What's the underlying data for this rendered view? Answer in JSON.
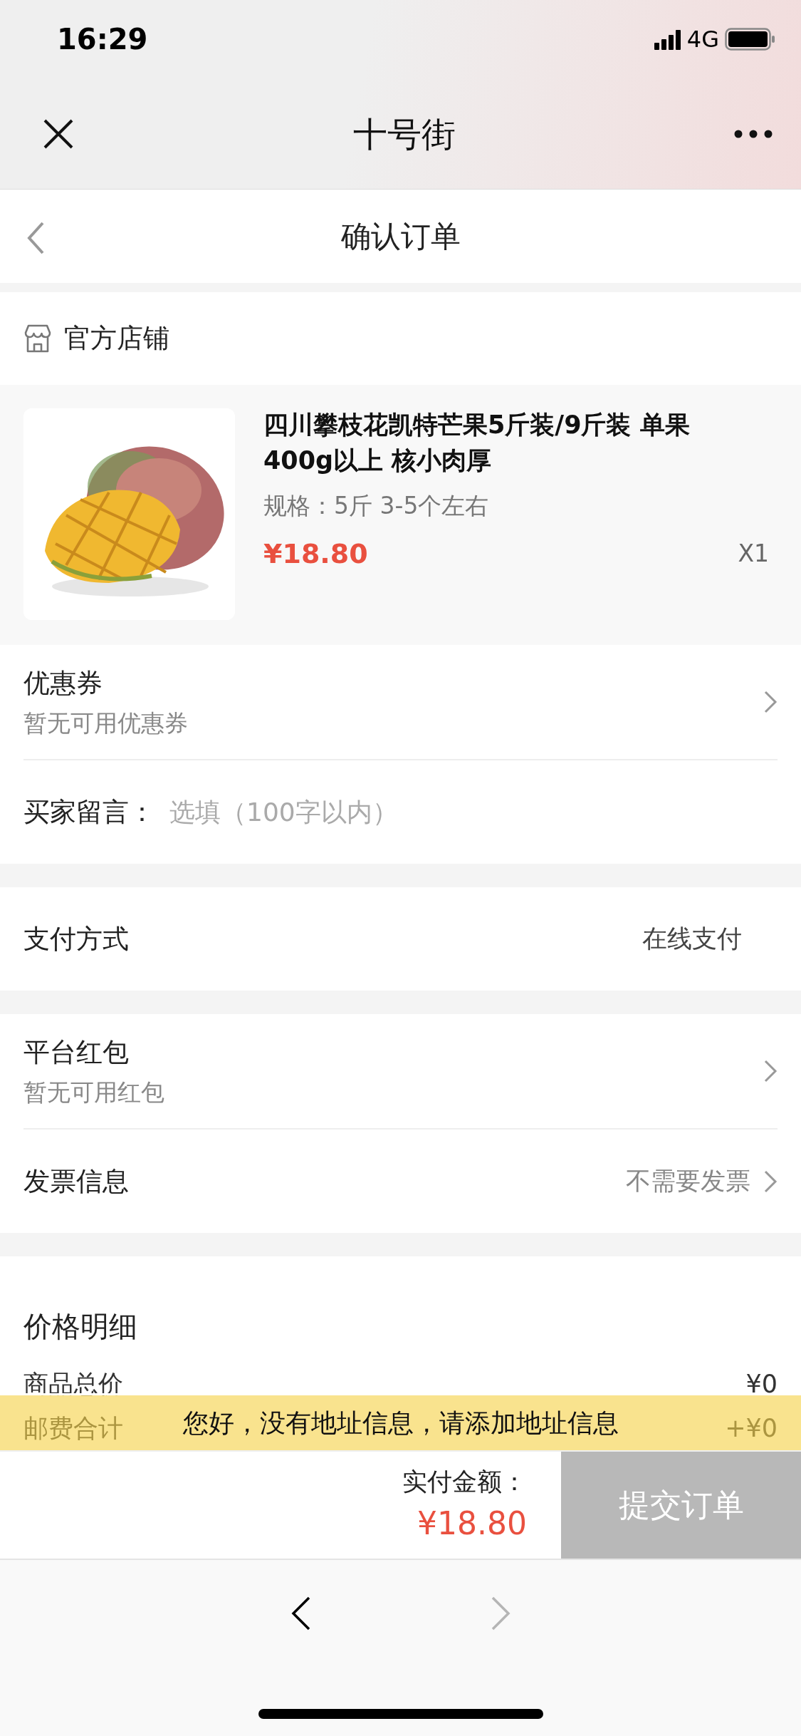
{
  "status_bar": {
    "time": "16:29",
    "network": "4G"
  },
  "app_bar": {
    "title": "十号街"
  },
  "header": {
    "title": "确认订单"
  },
  "store": {
    "name": "官方店铺"
  },
  "product": {
    "title": "四川攀枝花凯特芒果5斤装/9斤装 单果400g以上 核小肉厚",
    "spec": "规格：5斤 3-5个左右",
    "price": "¥18.80",
    "quantity": "X1"
  },
  "coupon": {
    "label": "优惠券",
    "hint": "暂无可用优惠券"
  },
  "message": {
    "label": "买家留言：",
    "placeholder": "选填（100字以内）"
  },
  "payment": {
    "label": "支付方式",
    "value": "在线支付"
  },
  "red_packet": {
    "label": "平台红包",
    "hint": "暂无可用红包"
  },
  "invoice": {
    "label": "发票信息",
    "value": "不需要发票"
  },
  "price_details": {
    "title": "价格明细",
    "rows": [
      {
        "label": "商品总价",
        "value": "¥0"
      },
      {
        "label": "邮费合计",
        "value": "+¥0"
      }
    ]
  },
  "notice": "您好，没有地址信息，请添加地址信息",
  "footer": {
    "total_label": "实付金额：",
    "total": "¥18.80",
    "submit": "提交订单"
  },
  "browser_nav": {
    "back_disabled": false,
    "forward_disabled": true
  }
}
